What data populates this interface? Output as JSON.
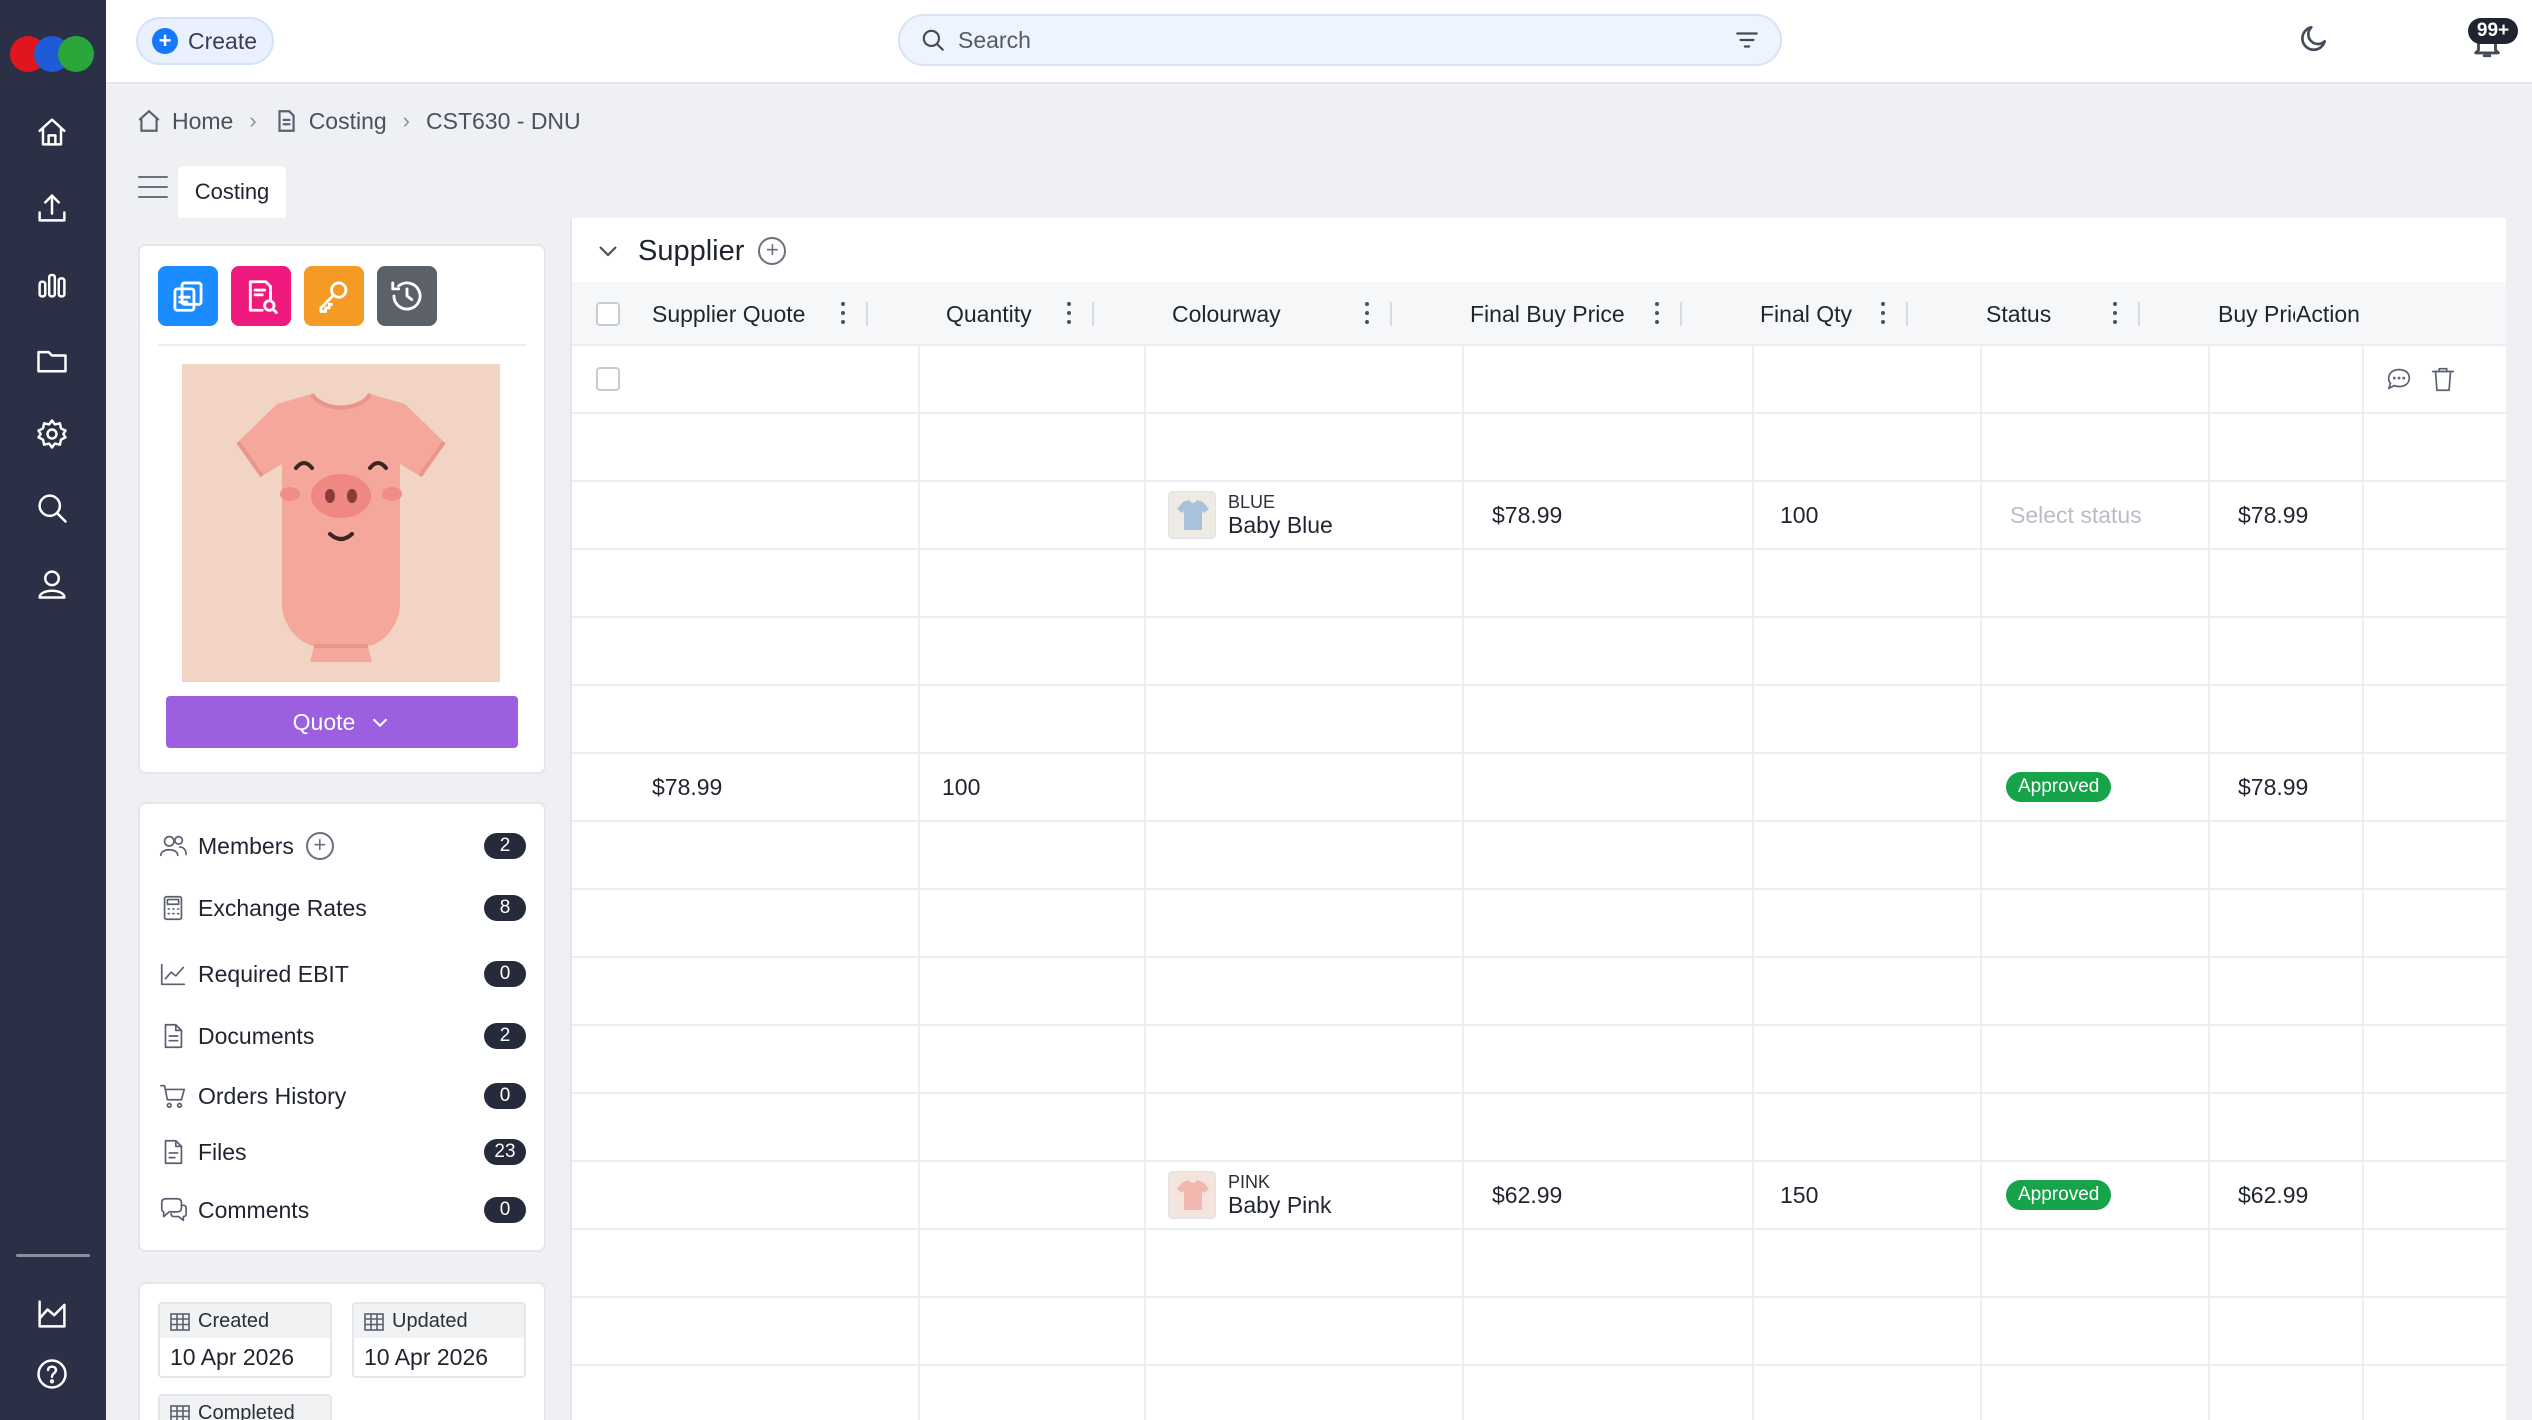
{
  "header": {
    "create_label": "Create",
    "search_placeholder": "Search",
    "notifications_count": "99+"
  },
  "breadcrumb": {
    "home": "Home",
    "section": "Costing",
    "current": "CST630 - DNU"
  },
  "tabs": [
    {
      "label": "Costing"
    }
  ],
  "sidebar_card": {
    "quote_label": "Quote",
    "app_icons": [
      "copy-docs-icon",
      "document-search-icon",
      "key-icon",
      "history-icon"
    ],
    "app_icon_colors": [
      "#1a8cff",
      "#f0197d",
      "#f59a23",
      "#5c6068"
    ]
  },
  "info_list": [
    {
      "label": "Members",
      "count": "2"
    },
    {
      "label": "Exchange Rates",
      "count": "8"
    },
    {
      "label": "Required EBIT",
      "count": "0"
    },
    {
      "label": "Documents",
      "count": "2"
    },
    {
      "label": "Orders History",
      "count": "0"
    },
    {
      "label": "Files",
      "count": "23"
    },
    {
      "label": "Comments",
      "count": "0"
    }
  ],
  "dates": {
    "created_label": "Created",
    "created_value": "10 Apr 2026",
    "updated_label": "Updated",
    "updated_value": "10 Apr 2026",
    "completed_label": "Completed"
  },
  "supplier": {
    "title": "Supplier",
    "columns": [
      "Supplier Quote",
      "Quantity",
      "Colourway",
      "Final Buy Price",
      "Final Qty",
      "Status",
      "Buy Price Lc",
      "Action"
    ],
    "status_placeholder": "Select status",
    "rows": {
      "r3": {
        "colour_code": "BLUE",
        "colour_name": "Baby Blue",
        "final_buy_price": "$78.99",
        "final_qty": "100",
        "buy_price_lc": "$78.99"
      },
      "r7": {
        "supplier_quote": "$78.99",
        "quantity": "100",
        "status": "Approved",
        "buy_price_lc": "$78.99"
      },
      "r13": {
        "colour_code": "PINK",
        "colour_name": "Baby Pink",
        "final_buy_price": "$62.99",
        "final_qty": "150",
        "status": "Approved",
        "buy_price_lc": "$62.99"
      }
    }
  },
  "colors": {
    "rail_bg": "#2b3046",
    "accent_blue": "#1677ff",
    "quote_purple": "#9b5fe0",
    "approved_green": "#16a34a"
  }
}
